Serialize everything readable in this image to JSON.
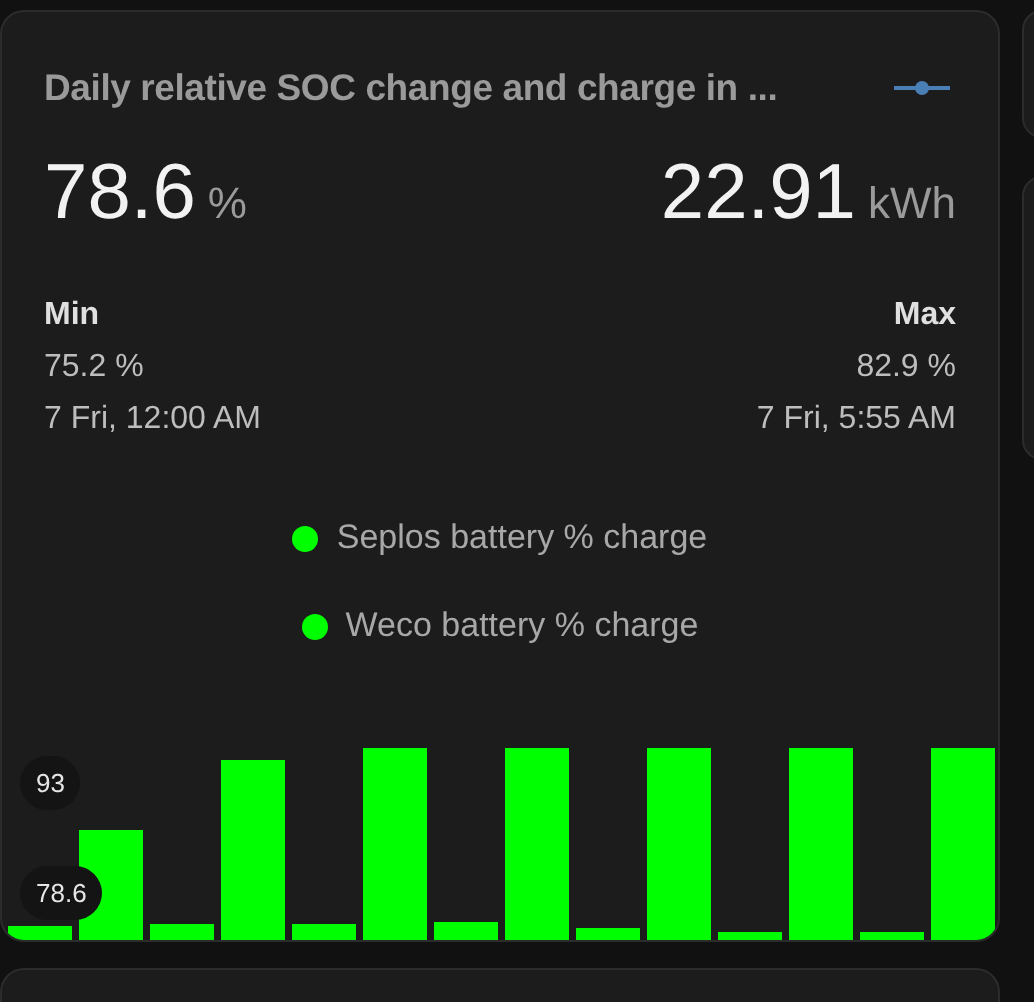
{
  "card": {
    "title": "Daily relative SOC change and charge in ...",
    "primary": {
      "value": "78.6",
      "unit": "%"
    },
    "secondary": {
      "value": "22.91",
      "unit": "kWh"
    },
    "min": {
      "label": "Min",
      "value": "75.2 %",
      "time": "7 Fri, 12:00 AM"
    },
    "max": {
      "label": "Max",
      "value": "82.9 %",
      "time": "7 Fri, 5:55 AM"
    },
    "legend": [
      {
        "label": "Seplos battery % charge",
        "color": "#00ff00"
      },
      {
        "label": "Weco battery % charge",
        "color": "#00ff00"
      }
    ],
    "chart_labels": [
      "93",
      "78.6"
    ]
  }
}
